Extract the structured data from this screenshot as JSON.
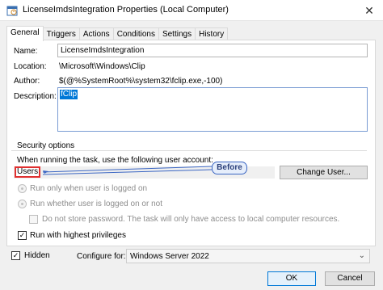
{
  "window": {
    "title": "LicenseImdsIntegration Properties (Local Computer)",
    "close_glyph": "✕"
  },
  "tabs": [
    {
      "label": "General",
      "active": true
    },
    {
      "label": "Triggers",
      "active": false
    },
    {
      "label": "Actions",
      "active": false
    },
    {
      "label": "Conditions",
      "active": false
    },
    {
      "label": "Settings",
      "active": false
    },
    {
      "label": "History",
      "active": false
    }
  ],
  "general": {
    "name_label": "Name:",
    "name_value": "LicenseImdsIntegration",
    "location_label": "Location:",
    "location_value": "\\Microsoft\\Windows\\Clip",
    "author_label": "Author:",
    "author_value": "$(@%SystemRoot%\\system32\\fclip.exe,-100)",
    "description_label": "Description:",
    "description_value": "fClip"
  },
  "security": {
    "section_label": "Security options",
    "prompt_text": "When running the task, use the following user account:",
    "user_value": "Users",
    "change_user_button": "Change User...",
    "radio_logged_on": "Run only when user is logged on",
    "radio_whether": "Run whether user is logged on or not",
    "do_not_store": "Do not store password.  The task will only have access to local computer resources.",
    "highest_privileges": "Run with highest privileges",
    "highest_privileges_checked": true
  },
  "annotation": {
    "callout_text": "Before",
    "color": "#3b66c3"
  },
  "footer": {
    "hidden_label": "Hidden",
    "hidden_checked": true,
    "configure_label": "Configure for:",
    "configure_value": "Windows Server 2022",
    "ok_button": "OK",
    "cancel_button": "Cancel"
  },
  "colors": {
    "selection": "#0078d7",
    "highlight_border": "#e03030",
    "dialog_bg": "#f0f0f0"
  }
}
